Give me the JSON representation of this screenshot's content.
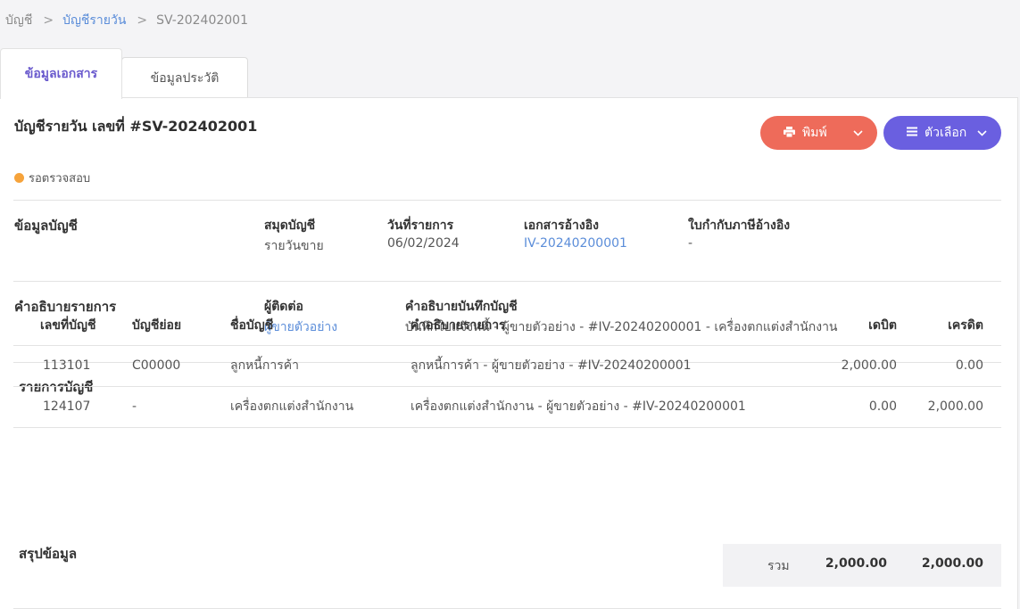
{
  "breadcrumb": {
    "items": [
      "บัญชี",
      "บัญชีรายวัน",
      "SV-202402001"
    ],
    "separator": ">"
  },
  "tabs": [
    {
      "label": "ข้อมูลเอกสาร",
      "active": true
    },
    {
      "label": "ข้อมูลประวัติ",
      "active": false
    }
  ],
  "header": {
    "title": "บัญชีรายวัน เลขที่ #SV-202402001",
    "status": "รอตรวจสอบ",
    "status_color": "#f6a33b",
    "print_button": {
      "label": "พิมพ์",
      "icon": "printer-icon",
      "color": "#ee6b5a"
    },
    "options_button": {
      "label": "ตัวเลือก",
      "icon": "menu-icon",
      "color": "#6a5fe0"
    }
  },
  "account_info": {
    "section_title": "ข้อมูลบัญชี",
    "fields": [
      {
        "label": "สมุดบัญชี",
        "value": "รายวันขาย"
      },
      {
        "label": "วันที่รายการ",
        "value": "06/02/2024"
      },
      {
        "label": "เอกสารอ้างอิง",
        "value": "IV-20240200001"
      },
      {
        "label": "ใบกำกับภาษีอ้างอิง",
        "value": "-"
      }
    ]
  },
  "description": {
    "section_title": "คำอธิบายรายการ",
    "contact_label": "ผู้ติดต่อ",
    "contact_value": "ผู้ขายตัวอย่าง",
    "note_label": "คำอธิบายบันทึกบัญชี",
    "note_value": "บันทึกใบแจ้งหนี้ - ผู้ขายตัวอย่าง - #IV-20240200001 - เครื่องตกแต่งสำนักงาน"
  },
  "entries": {
    "section_title": "รายการบัญชี",
    "columns": [
      "เลขที่บัญชี",
      "บัญชีย่อย",
      "ชื่อบัญชี",
      "คำอธิบายรายการ",
      "เดบิต",
      "เครดิต"
    ],
    "rows": [
      {
        "account_no": "113101",
        "sub_account": "C00000",
        "name": "ลูกหนี้การค้า",
        "description": "ลูกหนี้การค้า - ผู้ขายตัวอย่าง - #IV-20240200001",
        "debit": "2,000.00",
        "credit": "0.00"
      },
      {
        "account_no": "124107",
        "sub_account": "-",
        "name": "เครื่องตกแต่งสำนักงาน",
        "description": "เครื่องตกแต่งสำนักงาน - ผู้ขายตัวอย่าง - #IV-20240200001",
        "debit": "0.00",
        "credit": "2,000.00"
      }
    ]
  },
  "summary": {
    "section_title": "สรุปข้อมูล",
    "total_label": "รวม",
    "total_debit": "2,000.00",
    "total_credit": "2,000.00"
  }
}
